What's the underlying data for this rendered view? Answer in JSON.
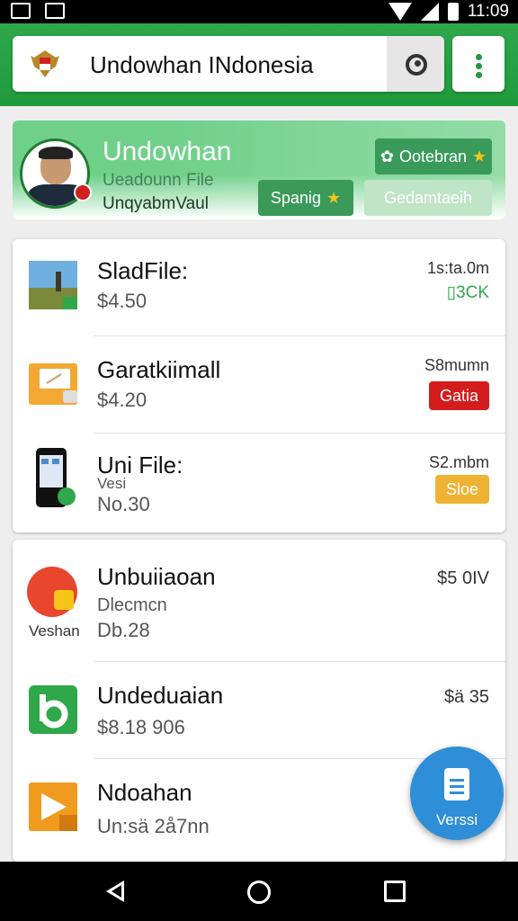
{
  "status_bar": {
    "time": "11:09"
  },
  "app_bar": {
    "title": "Undowhan INdonesia"
  },
  "profile": {
    "name": "Undowhan",
    "subtitle": "Ueadounn File",
    "username": "UnqyabmVaul",
    "chips": [
      {
        "label": "Ootebran"
      },
      {
        "label": "Spanig"
      },
      {
        "label": "Gedamtaeih"
      }
    ]
  },
  "files_card": {
    "items": [
      {
        "title": "SladFile:",
        "price": "$4.50",
        "meta": "1s:ta.0m",
        "tag": "3CK",
        "tag_color": "#2ea84a"
      },
      {
        "title": "Garatkiimall",
        "price": "$4.20",
        "meta": "S8mumn",
        "tag": "Gatia",
        "tag_color": "#d41c1c"
      },
      {
        "title": "Uni File:",
        "sub": "Vesi",
        "price": "No.30",
        "meta": "S2.mbm",
        "tag": "Sloe",
        "tag_color": "#f0b233"
      }
    ]
  },
  "apps_card": {
    "items": [
      {
        "title": "Unbuiiaoan",
        "sub": "Dlecmcn",
        "price": "Db.28",
        "meta": "$5 0IV",
        "icon_label": "Veshan"
      },
      {
        "title": "Undeduaian",
        "price": "$8.18 906",
        "meta": "$ä 35"
      },
      {
        "title": "Ndoahan",
        "price": "Un:sä 2å7nn"
      }
    ]
  },
  "fab": {
    "label": "Verssi"
  },
  "colors": {
    "primary": "#1f9a3c",
    "fab": "#2f8ed8",
    "red": "#d41c1c",
    "amber": "#f0b233"
  },
  "icons": [
    "gallery-icon",
    "image-icon",
    "wifi-icon",
    "signal-icon",
    "battery-icon",
    "emblem-icon",
    "lens-icon",
    "more-vert-icon",
    "document-icon",
    "back-icon",
    "home-icon",
    "recents-icon"
  ]
}
